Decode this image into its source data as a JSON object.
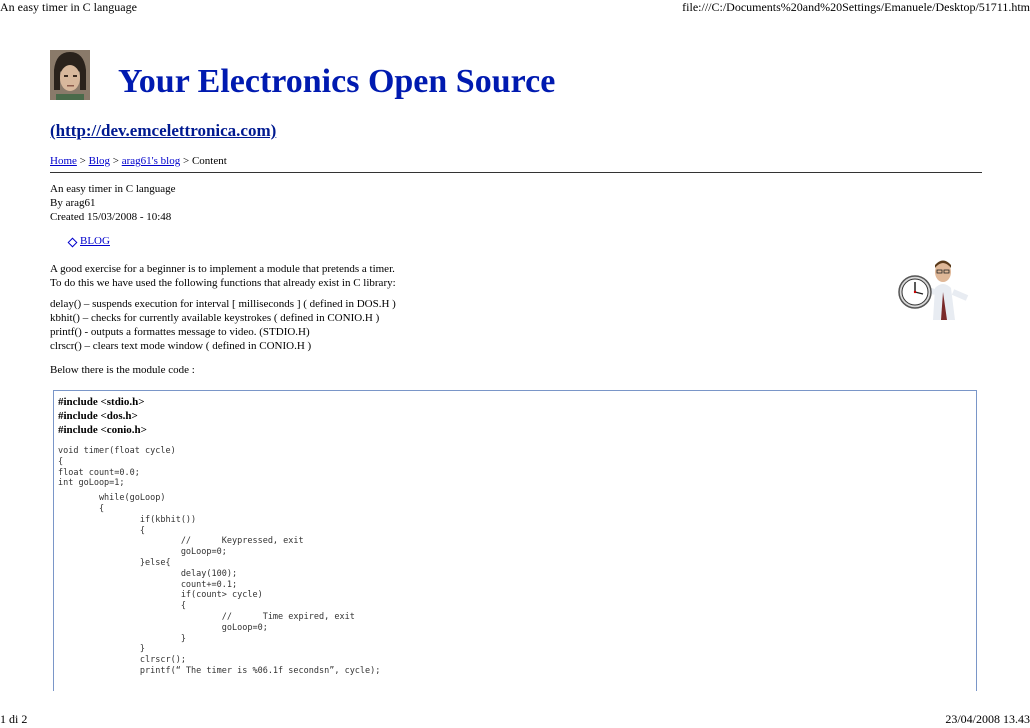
{
  "header": {
    "title": "An easy timer in C language",
    "url": "file:///C:/Documents%20and%20Settings/Emanuele/Desktop/51711.htm"
  },
  "footer": {
    "page": "1 di 2",
    "datetime": "23/04/2008 13.43"
  },
  "site": {
    "title": "Your Electronics Open Source",
    "url": "(http://dev.emcelettronica.com)"
  },
  "breadcrumb": {
    "home": "Home",
    "sep1": ">",
    "blog": "Blog",
    "sep2": ">",
    "user_blog": "arag61's blog",
    "sep3": ">",
    "current": "Content"
  },
  "article": {
    "title": "An easy timer in C language",
    "by": "By arag61",
    "created": "Created 15/03/2008 - 10:48",
    "tag": "BLOG",
    "intro_1": "A good exercise for a beginner is to implement a module that pretends a timer.",
    "intro_2": "To do this we have used the following functions that already exist in C library:",
    "func_1": "delay() – suspends execution for interval [ milliseconds ] ( defined in DOS.H )",
    "func_2": "kbhit() – checks for currently available keystrokes ( defined in CONIO.H )",
    "func_3": "printf() - outputs a formattes message to video. (STDIO.H)",
    "func_4": "clrscr() – clears text mode window ( defined in CONIO.H )",
    "below": "Below there is the module code :"
  },
  "code": {
    "includes": [
      "#include <stdio.h>",
      "#include <dos.h>",
      "#include <conio.h>"
    ],
    "lines": [
      "void timer(float cycle)",
      "{",
      "float count=0.0;",
      "int goLoop=1;",
      "",
      "        while(goLoop)",
      "        {",
      "                if(kbhit())",
      "                {",
      "                        //      Keypressed, exit",
      "                        goLoop=0;",
      "                }else{",
      "                        delay(100);",
      "                        count+=0.1;",
      "                        if(count> cycle)",
      "                        {",
      "                                //      Time expired, exit",
      "                                goLoop=0;",
      "                        }",
      "                }",
      "                clrscr();",
      "                printf(“ The timer is %06.1f secondsn”, cycle);"
    ]
  }
}
